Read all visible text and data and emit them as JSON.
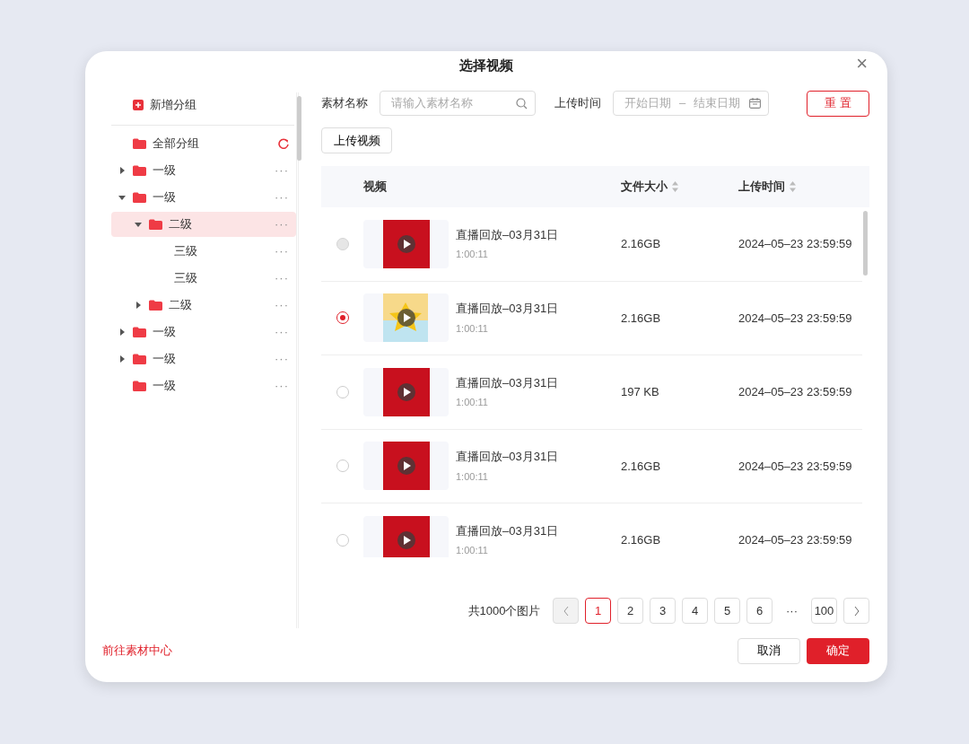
{
  "dialog": {
    "title": "选择视频",
    "close": "×"
  },
  "sidebar": {
    "add_group": "新增分组",
    "all_groups": "全部分组",
    "tree": [
      {
        "label": "一级",
        "kind": "folder",
        "expanded": false,
        "selected": false,
        "more": "···"
      },
      {
        "label": "一级",
        "kind": "folder",
        "expanded": true,
        "selected": false,
        "more": "···",
        "children": [
          {
            "label": "二级",
            "kind": "folder",
            "expanded": true,
            "selected": true,
            "more": "···",
            "children": [
              {
                "label": "三级",
                "kind": "plain",
                "selected": false,
                "more": "···"
              },
              {
                "label": "三级",
                "kind": "plain",
                "selected": false,
                "more": "···"
              }
            ]
          },
          {
            "label": "二级",
            "kind": "folder",
            "expanded": false,
            "selected": false,
            "more": "···"
          }
        ]
      },
      {
        "label": "一级",
        "kind": "folder",
        "expanded": false,
        "selected": false,
        "more": "···"
      },
      {
        "label": "一级",
        "kind": "folder",
        "expanded": false,
        "selected": false,
        "more": "···"
      },
      {
        "label": "一级",
        "kind": "folder",
        "selected": false,
        "more": "···"
      }
    ]
  },
  "filters": {
    "name_label": "素材名称",
    "name_placeholder": "请输入素材名称",
    "time_label": "上传时间",
    "start_placeholder": "开始日期",
    "separator": "–",
    "end_placeholder": "结束日期",
    "reset": "重 置"
  },
  "upload_button": "上传视频",
  "table": {
    "columns": [
      "视频",
      "文件大小",
      "上传时间"
    ],
    "rows": [
      {
        "selected": false,
        "disabled": true,
        "kind": "poster",
        "title": "直播回放–03月31日",
        "duration": "1:00:11",
        "size": "2.16GB",
        "time": "2024–05–23 23:59:59"
      },
      {
        "selected": true,
        "disabled": false,
        "kind": "illustration",
        "title": "直播回放–03月31日",
        "duration": "1:00:11",
        "size": "2.16GB",
        "time": "2024–05–23 23:59:59"
      },
      {
        "selected": false,
        "disabled": false,
        "kind": "poster",
        "title": "直播回放–03月31日",
        "duration": "1:00:11",
        "size": "197 KB",
        "time": "2024–05–23 23:59:59"
      },
      {
        "selected": false,
        "disabled": false,
        "kind": "poster",
        "title": "直播回放–03月31日",
        "duration": "1:00:11",
        "size": "2.16GB",
        "time": "2024–05–23 23:59:59"
      },
      {
        "selected": false,
        "disabled": false,
        "kind": "poster",
        "title": "直播回放–03月31日",
        "duration": "1:00:11",
        "size": "2.16GB",
        "time": "2024–05–23 23:59:59"
      }
    ]
  },
  "pagination": {
    "total": "共1000个图片",
    "prev_disabled": true,
    "pages": [
      {
        "label": "1",
        "selected": true
      },
      {
        "label": "2",
        "selected": false
      },
      {
        "label": "3",
        "selected": false
      },
      {
        "label": "4",
        "selected": false
      },
      {
        "label": "5",
        "selected": false
      },
      {
        "label": "6",
        "selected": false
      },
      {
        "label": "···",
        "kind": "ellipsis",
        "selected": false
      },
      {
        "label": "100",
        "selected": false
      }
    ]
  },
  "footer": {
    "link": "前往素材中心",
    "cancel": "取消",
    "confirm": "确定"
  }
}
